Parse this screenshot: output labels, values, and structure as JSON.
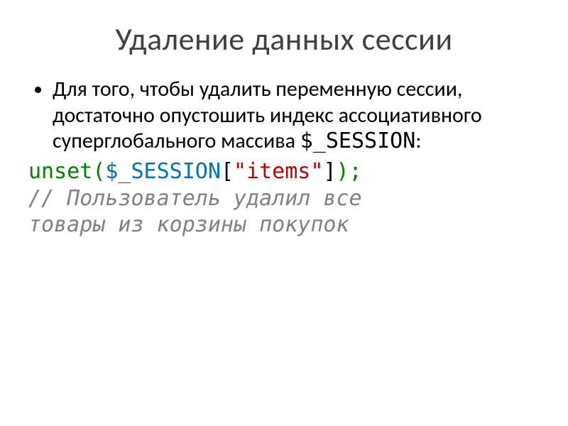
{
  "title": "Удаление данных сессии",
  "bullet": {
    "text_pre": "Для того, чтобы удалить переменную сессии, достаточно опустошить индекс ассоциативного суперглобального массива ",
    "session_var": "$_SESSION",
    "text_post": ":"
  },
  "code": {
    "unset": "unset",
    "lparen": "(",
    "var": "$_SESSION",
    "lbrack": "[",
    "str": "\"items\"",
    "rbrack": "]",
    "rparen": ")",
    "semi": ";"
  },
  "comment": {
    "line1": "// Пользователь удалил все",
    "line2": "товары из корзины покупок"
  }
}
